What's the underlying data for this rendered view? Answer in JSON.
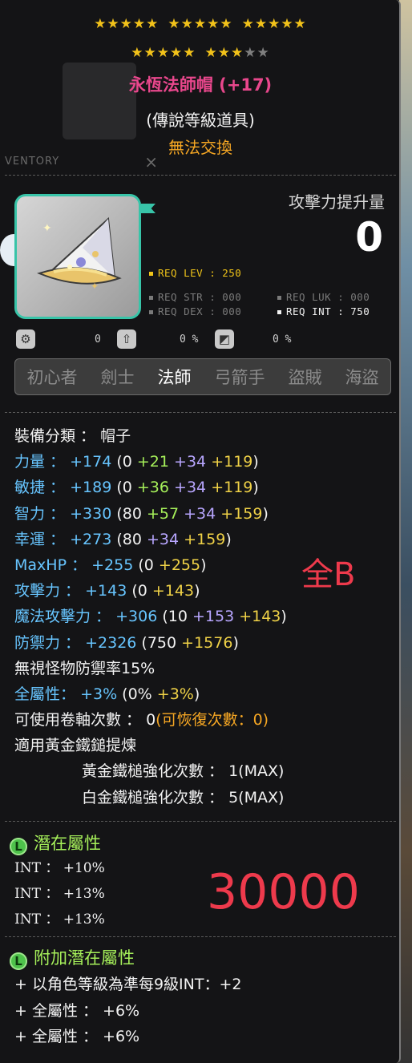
{
  "stars": {
    "row1": {
      "filled": 15,
      "groups": [
        5,
        5,
        5
      ]
    },
    "row2": {
      "filled": 8,
      "empty": 2,
      "groups": [
        5,
        5
      ]
    }
  },
  "item": {
    "name": "永恆法師帽 (+17)",
    "grade": "(傳說等級道具)",
    "trade": "無法交換"
  },
  "background_ui": {
    "inventory_label": "VENTORY",
    "close": "×"
  },
  "attack_box": {
    "label": "攻擊力提升量",
    "value": "0"
  },
  "requirements": {
    "lev": "REQ LEV : 250",
    "str": "REQ STR : 000",
    "luk": "REQ LUK : 000",
    "dex": "REQ DEX : 000",
    "int": "REQ INT : 750"
  },
  "icon_row": {
    "pct1": "0",
    "pct2": "0 %",
    "pct3": "0 %"
  },
  "jobs": [
    "初心者",
    "劍士",
    "法師",
    "弓箭手",
    "盜賊",
    "海盜"
  ],
  "active_job": "法師",
  "stats": {
    "category": "裝備分類 ： 帽子",
    "str": {
      "label": "力量 ：",
      "total": "+174",
      "open": "(0",
      "a": "+21",
      "b": "+34",
      "c": "+119",
      "close": ")"
    },
    "dex": {
      "label": "敏捷 ：",
      "total": "+189",
      "open": "(0",
      "a": "+36",
      "b": "+34",
      "c": "+119",
      "close": ")"
    },
    "int": {
      "label": "智力 ：",
      "total": "+330",
      "open": "(80",
      "a": "+57",
      "b": "+34",
      "c": "+159",
      "close": ")"
    },
    "luk": {
      "label": "幸運 ：",
      "total": "+273",
      "open": "(80",
      "b": "+34",
      "c": "+159",
      "close": ")"
    },
    "hp": {
      "label": "MaxHP ：",
      "total": "+255",
      "open": "(0",
      "c": "+255",
      "close": ")"
    },
    "atk": {
      "label": "攻擊力 ：",
      "total": "+143",
      "open": "(0",
      "c": "+143",
      "close": ")"
    },
    "matk": {
      "label": "魔法攻擊力 ：",
      "total": "+306",
      "open": "(10",
      "b": "+153",
      "c": "+143",
      "close": ")"
    },
    "def": {
      "label": "防禦力 ：",
      "total": "+2326",
      "open": "(750",
      "c": "+1576",
      "close": ")"
    },
    "ignore_def": "無視怪物防禦率15%",
    "allstat": {
      "label": "全屬性：",
      "total": "+3%",
      "open": "(0%",
      "c": "+3%",
      "close": ")"
    },
    "scroll": {
      "label": "可使用卷軸次數 ： 0",
      "extra": "(可恢復次數：0)"
    },
    "hammer": "適用黃金鐵鎚提煉",
    "gold_hammer": "黃金鐵槌強化次數 ： 1(MAX)",
    "plat_hammer": "白金鐵槌強化次數 ： 5(MAX)"
  },
  "annotations": {
    "full_b": "全B",
    "price": "30000"
  },
  "potential": {
    "title": "潛在屬性",
    "lines": [
      "INT ： +10%",
      "INT ： +13%",
      "INT ： +13%"
    ]
  },
  "bonus_potential": {
    "title": "附加潛在屬性",
    "lines": [
      "+ 以角色等級為準每9級INT：+2",
      "+ 全屬性 ： +6%",
      "+ 全屬性 ： +6%"
    ]
  },
  "colors": {
    "title": "#e8478c",
    "cyan": "#67c5ff",
    "green": "#a6f05a",
    "purple": "#b8a6ff",
    "yellow": "#f0d247",
    "orange": "#f5a623",
    "annotation": "#ee3a4c",
    "frame": "#38c4a8"
  }
}
